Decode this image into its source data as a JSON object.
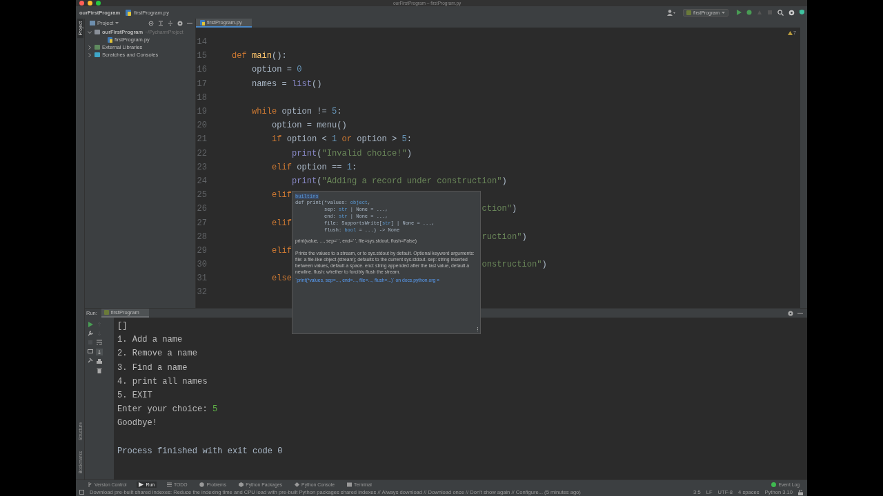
{
  "window": {
    "title": "ourFirstProgram – firstProgram.py"
  },
  "breadcrumb": [
    "ourFirstProgram",
    "firstProgram.py"
  ],
  "toolbar": {
    "run_config": "firstProgram"
  },
  "side_strip": {
    "top": [
      {
        "label": "Project",
        "selected": true
      }
    ],
    "bottom": [
      {
        "label": "Structure",
        "selected": false
      },
      {
        "label": "Bookmarks",
        "selected": false
      }
    ]
  },
  "project_panel": {
    "title": "Project",
    "tree": [
      {
        "label": "ourFirstProgram",
        "hint": "~/PycharmProject",
        "kind": "folder",
        "expanded": true,
        "children": [
          {
            "label": "firstProgram.py",
            "kind": "file"
          }
        ]
      },
      {
        "label": "External Libraries",
        "kind": "library",
        "expanded": false
      },
      {
        "label": "Scratches and Consoles",
        "kind": "scratch",
        "expanded": false
      }
    ]
  },
  "editor": {
    "tabs": [
      {
        "label": "firstProgram.py",
        "selected": true
      }
    ],
    "warnings": "7",
    "lines": [
      {
        "number": "14"
      },
      {
        "number": "15",
        "tokens": [
          {
            "kind": "kw",
            "text": "def "
          },
          {
            "kind": "fn",
            "text": "main"
          },
          {
            "kind": "plain",
            "text": "():"
          }
        ]
      },
      {
        "number": "16",
        "tokens": [
          {
            "kind": "plain",
            "text": "    option = "
          },
          {
            "kind": "num",
            "text": "0"
          }
        ]
      },
      {
        "number": "17",
        "tokens": [
          {
            "kind": "plain",
            "text": "    names = "
          },
          {
            "kind": "builtin",
            "text": "list"
          },
          {
            "kind": "plain",
            "text": "()"
          }
        ]
      },
      {
        "number": "18"
      },
      {
        "number": "19",
        "tokens": [
          {
            "kind": "kw",
            "text": "    while "
          },
          {
            "kind": "plain",
            "text": "option != "
          },
          {
            "kind": "num",
            "text": "5"
          },
          {
            "kind": "plain",
            "text": ":"
          }
        ]
      },
      {
        "number": "20",
        "tokens": [
          {
            "kind": "plain",
            "text": "        option = menu()"
          }
        ]
      },
      {
        "number": "21",
        "tokens": [
          {
            "kind": "kw",
            "text": "        if "
          },
          {
            "kind": "plain",
            "text": "option < "
          },
          {
            "kind": "num",
            "text": "1 "
          },
          {
            "kind": "kw",
            "text": "or "
          },
          {
            "kind": "plain",
            "text": "option > "
          },
          {
            "kind": "num",
            "text": "5"
          },
          {
            "kind": "plain",
            "text": ":"
          }
        ]
      },
      {
        "number": "22",
        "tokens": [
          {
            "kind": "builtin",
            "text": "            print"
          },
          {
            "kind": "plain",
            "text": "("
          },
          {
            "kind": "str",
            "text": "\"Invalid choice!\""
          },
          {
            "kind": "plain",
            "text": ")"
          }
        ]
      },
      {
        "number": "23",
        "tokens": [
          {
            "kind": "kw",
            "text": "        elif "
          },
          {
            "kind": "plain",
            "text": "option == "
          },
          {
            "kind": "num",
            "text": "1"
          },
          {
            "kind": "plain",
            "text": ":"
          }
        ]
      },
      {
        "number": "24",
        "tokens": [
          {
            "kind": "builtin",
            "text": "            print"
          },
          {
            "kind": "plain",
            "text": "("
          },
          {
            "kind": "str",
            "text": "\"Adding a record under construction\""
          },
          {
            "kind": "plain",
            "text": ")"
          }
        ]
      },
      {
        "number": "25",
        "tokens": [
          {
            "kind": "kw",
            "text": "        elif"
          }
        ]
      },
      {
        "number": "26",
        "tokens": [
          {
            "kind": "str",
            "text": "                                                  ction\""
          },
          {
            "kind": "plain",
            "text": ")"
          }
        ]
      },
      {
        "number": "27",
        "tokens": [
          {
            "kind": "kw",
            "text": "        elif"
          }
        ]
      },
      {
        "number": "28",
        "tokens": [
          {
            "kind": "str",
            "text": "                                                  ruction\""
          },
          {
            "kind": "plain",
            "text": ")"
          }
        ]
      },
      {
        "number": "29",
        "tokens": [
          {
            "kind": "kw",
            "text": "        elif"
          }
        ]
      },
      {
        "number": "30",
        "tokens": [
          {
            "kind": "str",
            "text": "                                                  onstruction\""
          },
          {
            "kind": "plain",
            "text": ")"
          }
        ]
      },
      {
        "number": "31",
        "tokens": [
          {
            "kind": "kw",
            "text": "        else"
          }
        ]
      },
      {
        "number": "32"
      }
    ]
  },
  "doc_popup": {
    "module": "builtins",
    "signature": [
      [
        {
          "kind": "plain",
          "text": "def print(*values: "
        },
        {
          "kind": "type",
          "text": "object"
        },
        {
          "kind": "plain",
          "text": ","
        }
      ],
      [
        {
          "kind": "plain",
          "text": "          sep: "
        },
        {
          "kind": "type",
          "text": "str"
        },
        {
          "kind": "plain",
          "text": " | None = ...,"
        }
      ],
      [
        {
          "kind": "plain",
          "text": "          end: "
        },
        {
          "kind": "type",
          "text": "str"
        },
        {
          "kind": "plain",
          "text": " | None = ...,"
        }
      ],
      [
        {
          "kind": "plain",
          "text": "          file: SupportsWrite["
        },
        {
          "kind": "type",
          "text": "str"
        },
        {
          "kind": "plain",
          "text": "] | None = ...,"
        }
      ],
      [
        {
          "kind": "plain",
          "text": "          flush: "
        },
        {
          "kind": "type",
          "text": "bool"
        },
        {
          "kind": "plain",
          "text": " = ...) -> None"
        }
      ]
    ],
    "usage": "print(value, ..., sep=' ', end=' ', file=sys.stdout, flush=False)",
    "description": "Prints the values to a stream, or to sys.stdout by default. Optional keyword arguments: file: a file-like object (stream); defaults to the current sys.stdout. sep: string inserted between values, default a space. end: string appended after the last value, default a newline. flush: whether to forcibly flush the stream.",
    "link": "`print(*values, sep=..., end=..., file=..., flush=...)` on docs.python.org »"
  },
  "run_panel": {
    "label": "Run:",
    "tabs": [
      {
        "label": "firstProgram",
        "selected": true
      }
    ],
    "output": [
      [
        {
          "kind": "out",
          "text": "[]"
        }
      ],
      [
        {
          "kind": "out",
          "text": "1. Add a name"
        }
      ],
      [
        {
          "kind": "out",
          "text": "2. Remove a name"
        }
      ],
      [
        {
          "kind": "out",
          "text": "3. Find a name"
        }
      ],
      [
        {
          "kind": "out",
          "text": "4. print all names"
        }
      ],
      [
        {
          "kind": "out",
          "text": "5. EXIT"
        }
      ],
      [
        {
          "kind": "out",
          "text": "Enter your choice: "
        },
        {
          "kind": "input",
          "text": "5"
        }
      ],
      [
        {
          "kind": "out",
          "text": "Goodbye!"
        }
      ],
      [
        {
          "kind": "system",
          "text": "Process finished with exit code 0"
        }
      ]
    ]
  },
  "tool_tabs": [
    {
      "label": "Version Control",
      "kind": "vcs",
      "selected": false
    },
    {
      "label": "Run",
      "kind": "run",
      "selected": true
    },
    {
      "label": "TODO",
      "kind": "todo",
      "selected": false
    },
    {
      "label": "Problems",
      "kind": "problems",
      "selected": false
    },
    {
      "label": "Python Packages",
      "kind": "packages",
      "selected": false
    },
    {
      "label": "Python Console",
      "kind": "console",
      "selected": false
    },
    {
      "label": "Terminal",
      "kind": "terminal",
      "selected": false
    }
  ],
  "event_log": "Event Log",
  "status_bar": {
    "message": "Download pre-built shared indexes: Reduce the indexing time and CPU load with pre-built Python packages shared indexes // Always download // Download once // Don't show again // Configure... (5 minutes ago)",
    "items": [
      "3:5",
      "LF",
      "UTF-8",
      "4 spaces",
      "Python 3.10"
    ]
  }
}
